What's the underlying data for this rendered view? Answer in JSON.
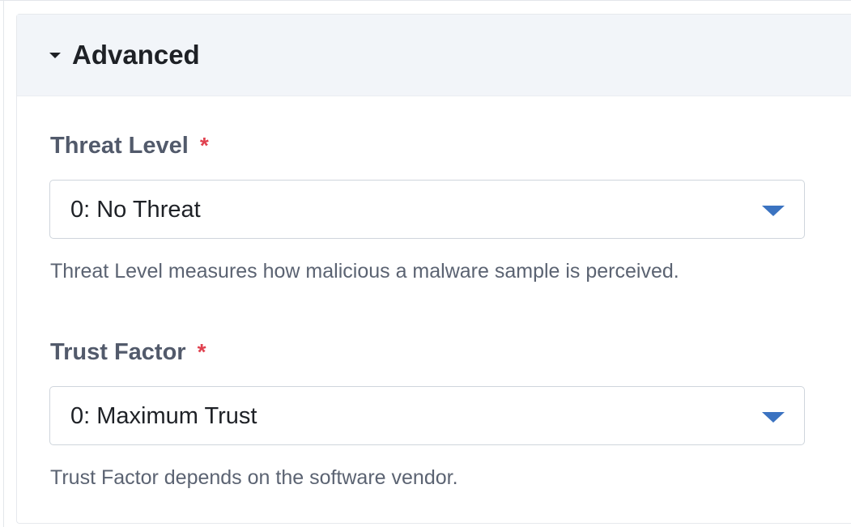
{
  "section": {
    "title": "Advanced",
    "expanded": true
  },
  "fields": [
    {
      "label": "Threat Level",
      "required_mark": "*",
      "selected_value": "0: No Threat",
      "help_text": "Threat Level measures how malicious a malware sample is perceived."
    },
    {
      "label": "Trust Factor",
      "required_mark": "*",
      "selected_value": "0: Maximum Trust",
      "help_text": "Trust Factor depends on the software vendor."
    }
  ],
  "colors": {
    "header_background": "#f2f5f9",
    "label": "#525a6b",
    "required": "#e0414f",
    "dropdown_caret": "#3b73c1",
    "help_text": "#5b6372"
  },
  "icons": {
    "section_toggle": "caret-down-icon",
    "dropdown": "chevron-down-icon"
  }
}
